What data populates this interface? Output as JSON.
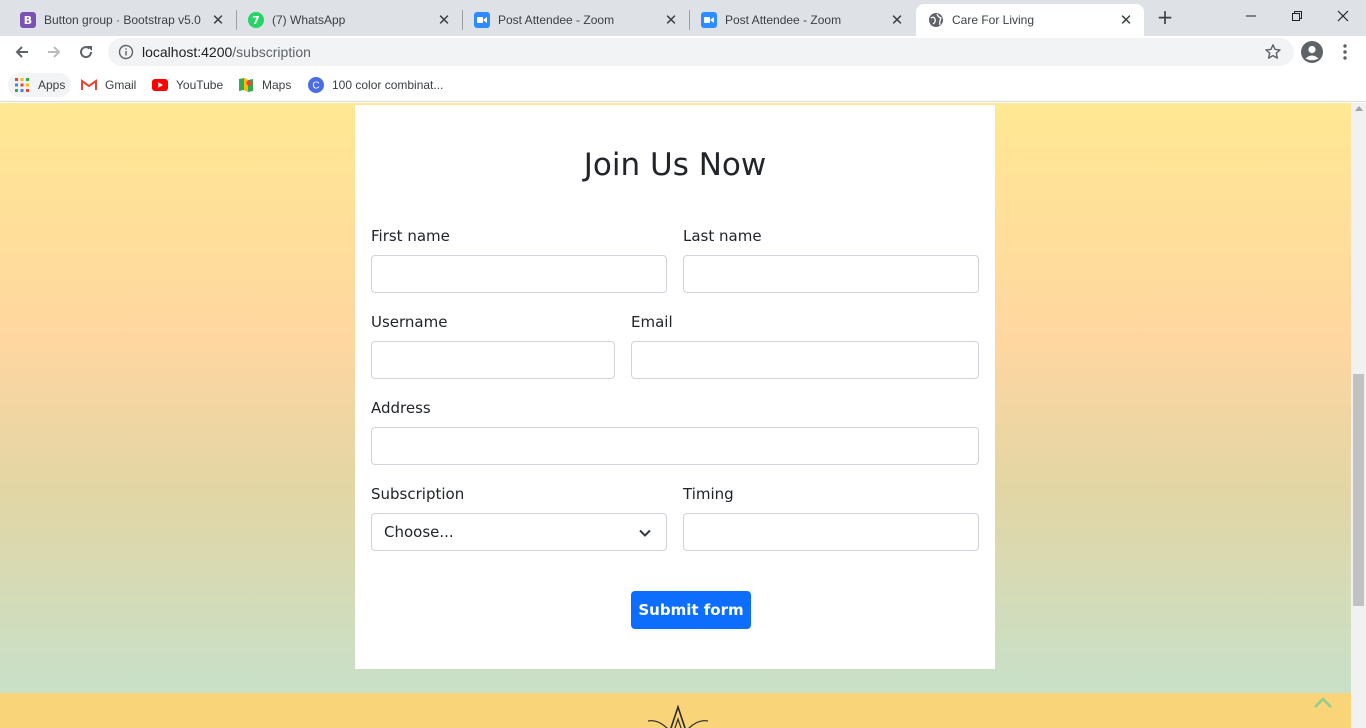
{
  "browser": {
    "tabs": [
      {
        "title": "Button group · Bootstrap v5.0",
        "favicon": "bootstrap-icon",
        "favicon_color": "#7952b3",
        "favicon_glyph": "B"
      },
      {
        "title": "(7) WhatsApp",
        "favicon": "whatsapp-icon",
        "favicon_color": "#25d366",
        "favicon_glyph": "7"
      },
      {
        "title": "Post Attendee - Zoom",
        "favicon": "zoom-icon",
        "favicon_color": "#2d8cff",
        "favicon_glyph": ""
      },
      {
        "title": "Post Attendee - Zoom",
        "favicon": "zoom-icon",
        "favicon_color": "#2d8cff",
        "favicon_glyph": ""
      },
      {
        "title": "Care For Living",
        "favicon": "globe-icon",
        "favicon_color": "#5f6368",
        "favicon_glyph": "",
        "active": true
      }
    ],
    "new_tab": "+",
    "url_host": "localhost:4200",
    "url_path": "/subscription",
    "bookmarks": [
      {
        "label": "Apps",
        "icon": "apps-grid-icon"
      },
      {
        "label": "Gmail",
        "icon": "gmail-icon"
      },
      {
        "label": "YouTube",
        "icon": "youtube-icon"
      },
      {
        "label": "Maps",
        "icon": "maps-icon"
      },
      {
        "label": "100 color combinat...",
        "icon": "canva-icon"
      }
    ]
  },
  "form": {
    "title": "Join Us Now",
    "first_name_label": "First name",
    "last_name_label": "Last name",
    "username_label": "Username",
    "email_label": "Email",
    "address_label": "Address",
    "subscription_label": "Subscription",
    "subscription_selected": "Choose...",
    "timing_label": "Timing",
    "submit_label": "Submit form"
  },
  "colors": {
    "primary_button": "#0d6efd",
    "footer": "#fad479"
  }
}
